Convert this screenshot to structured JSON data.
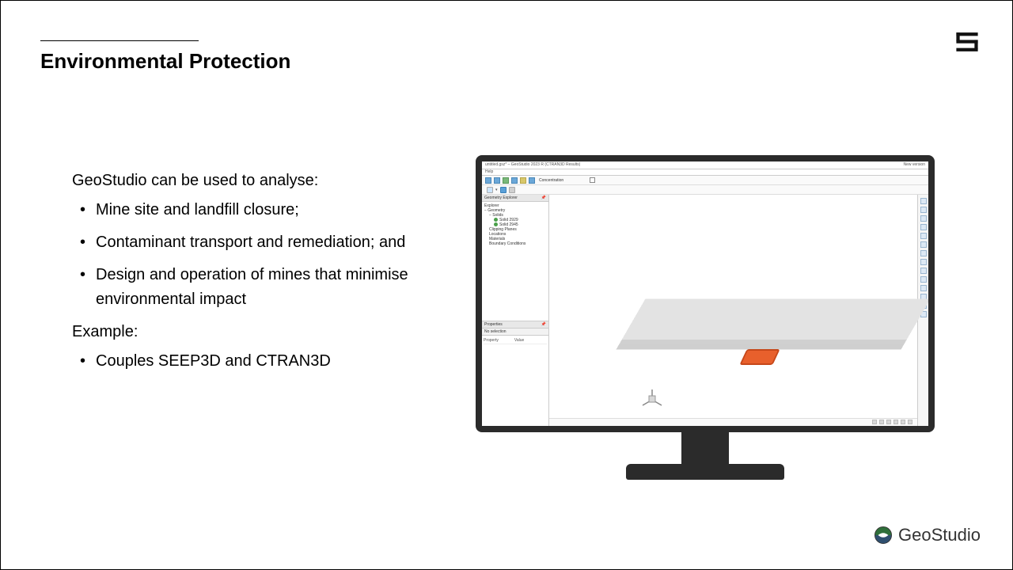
{
  "slide": {
    "title": "Environmental Protection",
    "intro": "GeoStudio can be used to analyse:",
    "bullets": [
      "Mine site and landfill closure;",
      "Contaminant transport and remediation; and",
      "Design and operation of mines that minimise environmental impact"
    ],
    "example_label": "Example:",
    "example_bullets": [
      "Couples SEEP3D and CTRAN3D"
    ]
  },
  "app": {
    "title_left": "untitled.gsz* – GeoStudio 2023 R (CTRAN3D Results)",
    "title_right": "New version",
    "menu": "Help",
    "toolbar_field_label": "Concentration",
    "toolbar2_dropdown": "▾",
    "explorer": {
      "header": "Geometry Explorer",
      "root": "Explorer",
      "items": {
        "geometry": "− Geometry",
        "solids": "− Solids",
        "solid1": "Solid 2929",
        "solid2": "Solid 2945",
        "clipping": "Clipping Planes",
        "locations": "Locations",
        "materials": "Materials",
        "boundary": "Boundary Conditions"
      }
    },
    "properties": {
      "header": "Properties",
      "subheader": "No selection",
      "col1": "Property",
      "col2": "Value"
    }
  },
  "branding": {
    "product_name": "GeoStudio"
  }
}
